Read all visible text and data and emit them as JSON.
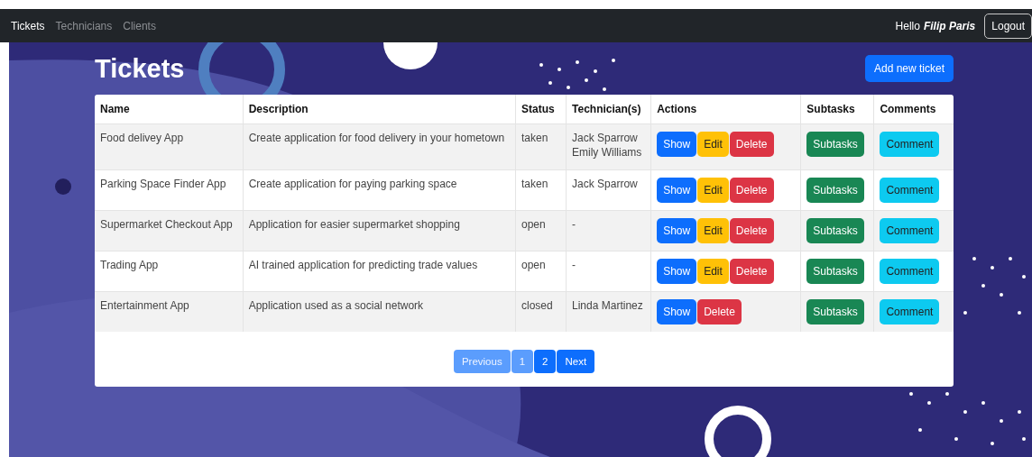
{
  "navbar": {
    "links": [
      {
        "label": "Tickets",
        "selected": true
      },
      {
        "label": "Technicians",
        "selected": false
      },
      {
        "label": "Clients",
        "selected": false
      }
    ],
    "greeting": "Hello",
    "user": "Filip Paris",
    "logout": "Logout"
  },
  "page_title": "Tickets",
  "add_button": "Add new ticket",
  "table": {
    "columns": [
      "Name",
      "Description",
      "Status",
      "Technician(s)",
      "Actions",
      "Subtasks",
      "Comments"
    ],
    "rows": [
      {
        "name": "Food delivey App",
        "description": "Create application for food delivery in your hometown",
        "status": "taken",
        "technicians": [
          "Jack Sparrow",
          "Emily Williams"
        ],
        "actions": [
          {
            "kind": "show",
            "label": "Show"
          },
          {
            "kind": "edit",
            "label": "Edit"
          },
          {
            "kind": "delete",
            "label": "Delete"
          }
        ],
        "subtasks": "Subtasks",
        "comment": "Comment"
      },
      {
        "name": "Parking Space Finder App",
        "description": "Create application for paying parking space",
        "status": "taken",
        "technicians": [
          "Jack Sparrow"
        ],
        "actions": [
          {
            "kind": "show",
            "label": "Show"
          },
          {
            "kind": "edit",
            "label": "Edit"
          },
          {
            "kind": "delete",
            "label": "Delete"
          }
        ],
        "subtasks": "Subtasks",
        "comment": "Comment"
      },
      {
        "name": "Supermarket Checkout App",
        "description": "Application for easier supermarket shopping",
        "status": "open",
        "technicians": [
          "-"
        ],
        "actions": [
          {
            "kind": "show",
            "label": "Show"
          },
          {
            "kind": "edit",
            "label": "Edit"
          },
          {
            "kind": "delete",
            "label": "Delete"
          }
        ],
        "subtasks": "Subtasks",
        "comment": "Comment"
      },
      {
        "name": "Trading App",
        "description": "AI trained application for predicting trade values",
        "status": "open",
        "technicians": [
          "-"
        ],
        "actions": [
          {
            "kind": "show",
            "label": "Show"
          },
          {
            "kind": "edit",
            "label": "Edit"
          },
          {
            "kind": "delete",
            "label": "Delete"
          }
        ],
        "subtasks": "Subtasks",
        "comment": "Comment"
      },
      {
        "name": "Entertainment App",
        "description": "Application used as a social network",
        "status": "closed",
        "technicians": [
          "Linda Martinez"
        ],
        "actions": [
          {
            "kind": "show",
            "label": "Show"
          },
          {
            "kind": "delete",
            "label": "Delete"
          }
        ],
        "subtasks": "Subtasks",
        "comment": "Comment"
      }
    ]
  },
  "pagination": [
    {
      "label": "Previous",
      "disabled": true
    },
    {
      "label": "1",
      "disabled": true
    },
    {
      "label": "2",
      "disabled": false
    },
    {
      "label": "Next",
      "disabled": false
    }
  ]
}
